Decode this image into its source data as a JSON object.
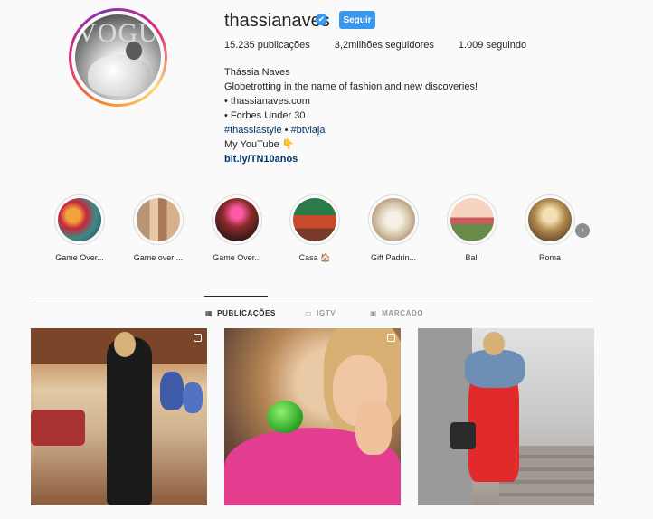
{
  "profile": {
    "username": "thassianaves",
    "verified_mark": "✔",
    "follow_label": "Seguir",
    "stats": {
      "posts": "15.235 publicações",
      "followers": "3,2milhões seguidores",
      "following": "1.009 seguindo"
    },
    "avatar_text": "VOGUE",
    "bio": {
      "full_name": "Thássia Naves",
      "line1": "Globetrotting in the name of fashion and new discoveries!",
      "line2": "• thassianaves.com",
      "line3": "• Forbes Under 30",
      "tag1": "#thassiastyle",
      "tag_sep": " • ",
      "tag2": "#btviaja",
      "line5": "My YouTube 👇",
      "link": "bit.ly/TN10anos"
    }
  },
  "highlights": [
    {
      "label": "Game Over..."
    },
    {
      "label": "Game over ..."
    },
    {
      "label": "Game Over..."
    },
    {
      "label": "Casa 🏠"
    },
    {
      "label": "Gift Padrin..."
    },
    {
      "label": "Bali"
    },
    {
      "label": "Roma"
    }
  ],
  "highlights_next_icon": "›",
  "tabs": [
    {
      "icon": "▦",
      "label": "PUBLICAÇÕES"
    },
    {
      "icon": "▭",
      "label": "IGTV"
    },
    {
      "icon": "▣",
      "label": "MARCADO"
    }
  ],
  "colors": {
    "accent": "#3897f0",
    "link": "#003569",
    "text": "#262626",
    "muted": "#999999"
  }
}
